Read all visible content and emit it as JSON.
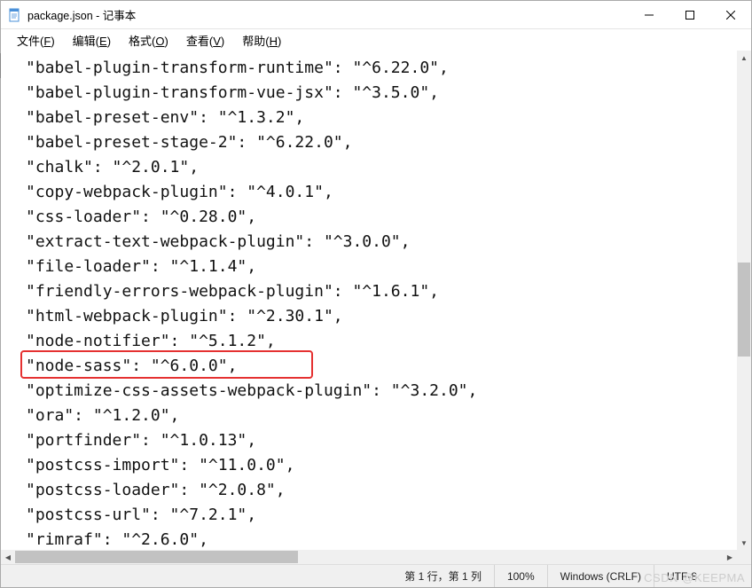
{
  "window": {
    "title": "package.json - 记事本"
  },
  "menu": {
    "file": {
      "label": "文件",
      "key": "F"
    },
    "edit": {
      "label": "编辑",
      "key": "E"
    },
    "format": {
      "label": "格式",
      "key": "O"
    },
    "view": {
      "label": "查看",
      "key": "V"
    },
    "help": {
      "label": "帮助",
      "key": "H"
    }
  },
  "code": {
    "lines": [
      "\"babel-plugin-transform-runtime\": \"^6.22.0\",",
      "\"babel-plugin-transform-vue-jsx\": \"^3.5.0\",",
      "\"babel-preset-env\": \"^1.3.2\",",
      "\"babel-preset-stage-2\": \"^6.22.0\",",
      "\"chalk\": \"^2.0.1\",",
      "\"copy-webpack-plugin\": \"^4.0.1\",",
      "\"css-loader\": \"^0.28.0\",",
      "\"extract-text-webpack-plugin\": \"^3.0.0\",",
      "\"file-loader\": \"^1.1.4\",",
      "\"friendly-errors-webpack-plugin\": \"^1.6.1\",",
      "\"html-webpack-plugin\": \"^2.30.1\",",
      "\"node-notifier\": \"^5.1.2\",",
      "\"node-sass\": \"^6.0.0\",",
      "\"optimize-css-assets-webpack-plugin\": \"^3.2.0\",",
      "\"ora\": \"^1.2.0\",",
      "\"portfinder\": \"^1.0.13\",",
      "\"postcss-import\": \"^11.0.0\",",
      "\"postcss-loader\": \"^2.0.8\",",
      "\"postcss-url\": \"^7.2.1\",",
      "\"rimraf\": \"^2.6.0\","
    ]
  },
  "highlight": {
    "lineIndex": 12
  },
  "status": {
    "position": "第 1 行，第 1 列",
    "zoom": "100%",
    "lineEnding": "Windows (CRLF)",
    "encoding": "UTF-8"
  },
  "watermark": "CSDN @KEEPMA"
}
